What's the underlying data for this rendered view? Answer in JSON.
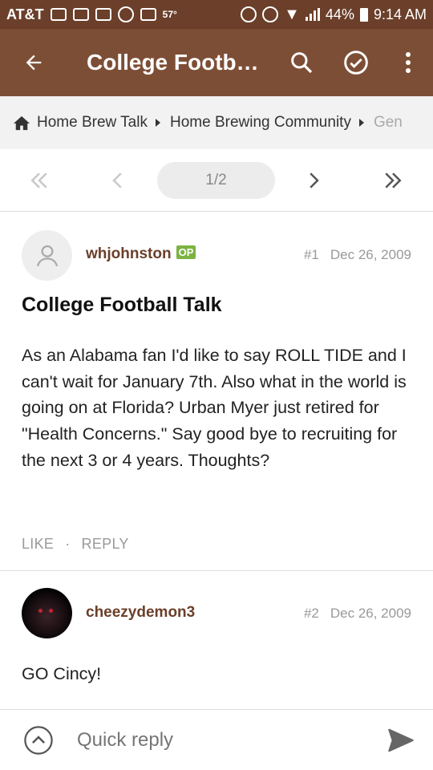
{
  "status_bar": {
    "carrier": "AT&T",
    "temperature": "57°",
    "battery": "44%",
    "time": "9:14 AM"
  },
  "app_bar": {
    "title": "College Footb…",
    "icons": [
      "back-arrow-icon",
      "search-icon",
      "check-circle-icon",
      "more-vert-icon"
    ]
  },
  "breadcrumb": {
    "items": [
      "Home Brew Talk",
      "Home Brewing Community",
      "Gen"
    ]
  },
  "pagination": {
    "current": "1/2"
  },
  "posts": [
    {
      "username": "whjohnston",
      "badge": "OP",
      "number": "#1",
      "date": "Dec 26, 2009",
      "title": "College Football Talk",
      "body": "As an Alabama fan I'd like to say ROLL TIDE and I can't wait for January 7th. Also what in the world is going on at Florida? Urban Myer just retired for \"Health Concerns.\" Say good bye to recruiting for the next 3 or 4 years. Thoughts?",
      "actions": {
        "like": "LIKE",
        "separator": "·",
        "reply": "REPLY"
      }
    },
    {
      "username": "cheezydemon3",
      "number": "#2",
      "date": "Dec 26, 2009",
      "body": "GO Cincy!"
    }
  ],
  "quick_reply": {
    "placeholder": "Quick reply"
  },
  "colors": {
    "status_bar": "#6b3f2a",
    "app_bar": "#7d4e36",
    "username": "#6b3f2a",
    "op_badge": "#7cb342"
  }
}
